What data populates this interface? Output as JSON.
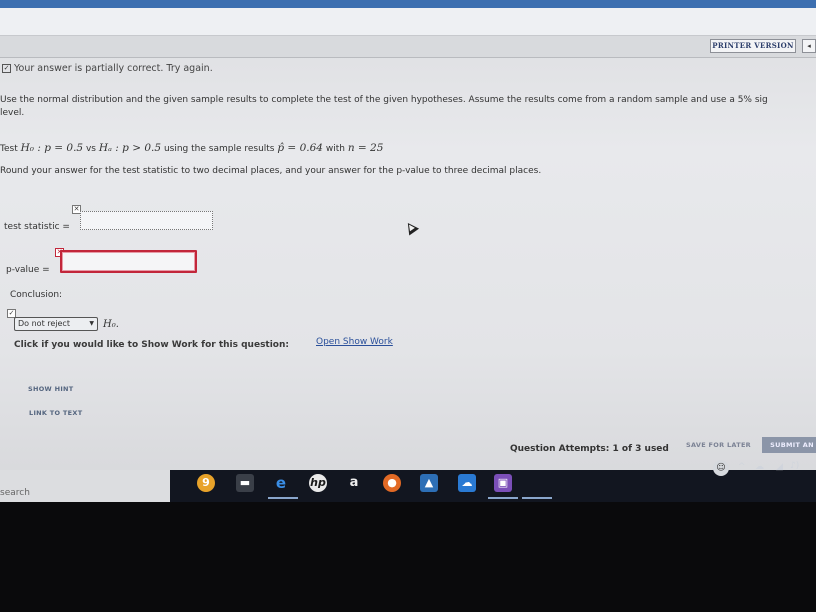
{
  "toolbar": {
    "printer_version": "PRINTER VERSION",
    "nav_arrow": "◂"
  },
  "status": {
    "message": "Your answer is partially correct.  Try again."
  },
  "question": {
    "intro_line1": "Use the normal distribution and the given sample results to complete the test of the given hypotheses. Assume the results come from a random sample and use a 5% sig",
    "intro_line2": "level.",
    "test_prefix": "Test",
    "h0": "H₀ : p = 0.5",
    "vs": "vs",
    "ha": "Hₐ : p > 0.5",
    "using": "using the sample results",
    "phat": "p̂ = 0.64",
    "with": "with",
    "n": "n = 25",
    "round_instr": "Round your answer for the test statistic to two decimal places, and your answer for the p-value to three decimal places."
  },
  "answers": {
    "test_statistic_label": "test statistic =",
    "test_statistic_value": "",
    "p_value_label": "p-value =",
    "p_value_value": "",
    "conclusion_label": "Conclusion:",
    "conclusion_selected": "Do not reject",
    "conclusion_suffix": "H₀."
  },
  "show_work": {
    "prompt": "Click if you would like to Show Work for this question:",
    "link": "Open Show Work"
  },
  "links": {
    "show_hint": "SHOW HINT",
    "link_to_text": "LINK TO TEXT"
  },
  "footer": {
    "attempts": "Question Attempts: 1 of 3 used",
    "save_later": "SAVE FOR LATER",
    "submit": "SUBMIT AN"
  },
  "taskbar": {
    "search_text": "search",
    "icons": [
      "chrome-icon",
      "file-explorer-icon",
      "edge-icon",
      "hp-icon",
      "amazon-icon",
      "firefox-icon",
      "photos-icon",
      "onedrive-icon",
      "app-icon"
    ]
  },
  "colors": {
    "accent": "#3c6fb0",
    "error": "#c2263a",
    "link": "#2a4f9a"
  }
}
